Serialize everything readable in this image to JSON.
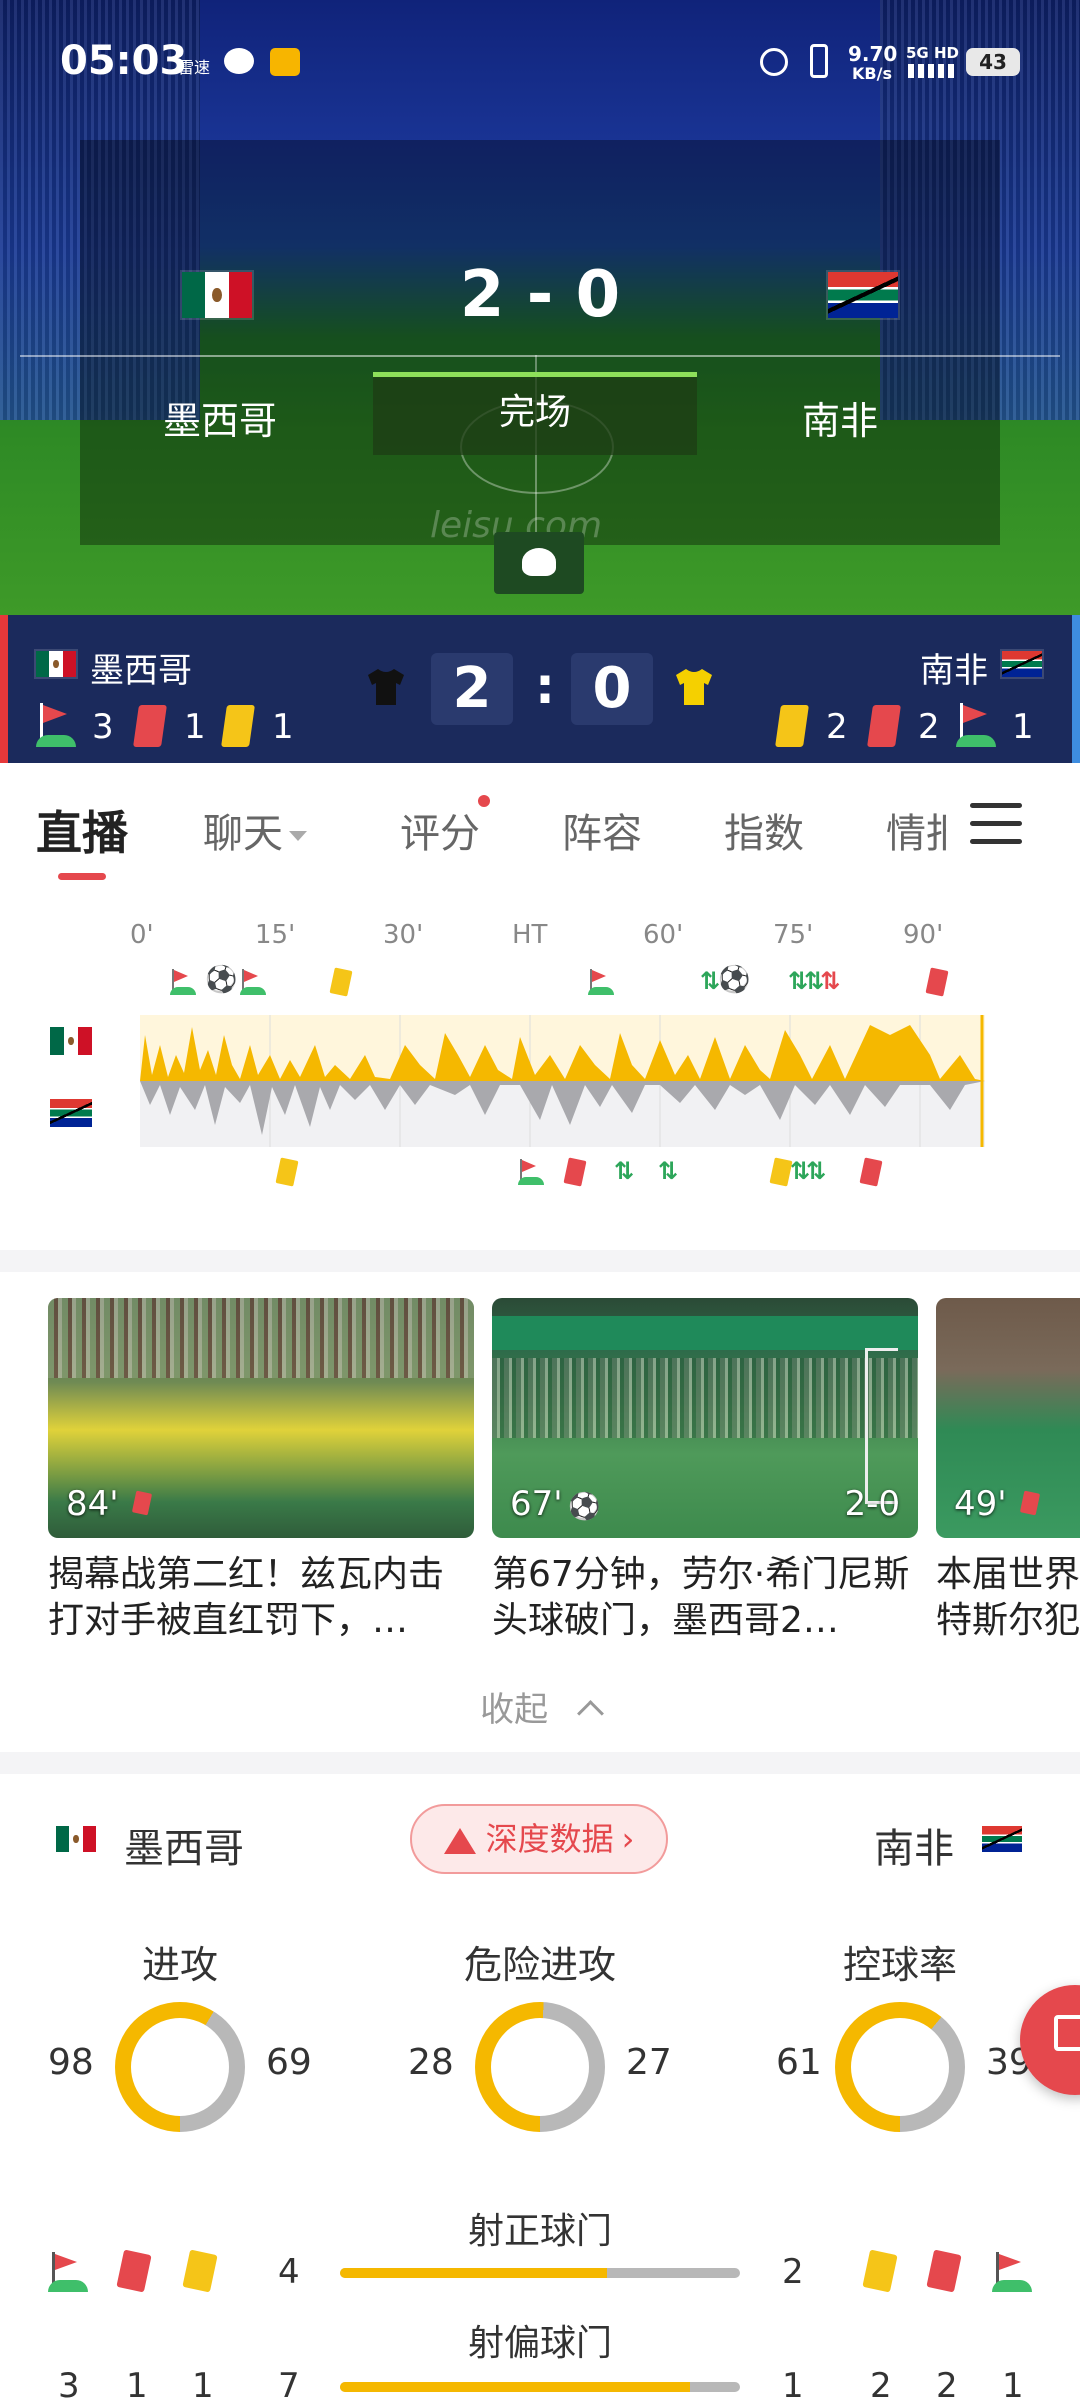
{
  "status_bar": {
    "time": "05:03",
    "app_label": "雷速",
    "network_speed": "9.70",
    "network_unit": "KB/s",
    "signal": "5G HD",
    "battery": "43"
  },
  "match": {
    "home_team": "墨西哥",
    "away_team": "南非",
    "score": "2 - 0",
    "home_score": "2",
    "away_score": "0",
    "score_sep": ":",
    "status": "完场",
    "watermark": "leisu.com",
    "home_stats": {
      "corners": "3",
      "red": "1",
      "yellow": "1"
    },
    "away_stats": {
      "yellow": "2",
      "red": "2",
      "corners": "1"
    },
    "colors": {
      "home_jersey": "#111111",
      "away_jersey": "#f5d000",
      "accent": "#e5484d"
    }
  },
  "tabs": [
    {
      "label": "直播",
      "active": true
    },
    {
      "label": "聊天",
      "dropdown": true
    },
    {
      "label": "评分",
      "dot": true
    },
    {
      "label": "阵容"
    },
    {
      "label": "指数"
    },
    {
      "label": "情报"
    }
  ],
  "timeline": {
    "ticks": [
      "0'",
      "15'",
      "30'",
      "HT",
      "60'",
      "75'",
      "90'"
    ]
  },
  "videos": [
    {
      "minute": "84'",
      "icon": "red-card",
      "title": "揭幕战第二红！兹瓦内击打对手被直红罚下，…"
    },
    {
      "minute": "67'",
      "icon": "ball",
      "score": "2-0",
      "title": "第67分钟，劳尔·希门尼斯头球破门，墨西哥2…"
    },
    {
      "minute": "49'",
      "icon": "red-card",
      "title": "本届世界杯首张红牌！蒙特斯尔犯规破…"
    }
  ],
  "collapse_label": "收起",
  "stats": {
    "home_team": "墨西哥",
    "away_team": "南非",
    "deep_data_label": "深度数据",
    "donuts": [
      {
        "title": "进攻",
        "home": "98",
        "away": "69",
        "home_value": 98,
        "away_value": 69
      },
      {
        "title": "危险进攻",
        "home": "28",
        "away": "27",
        "home_value": 28,
        "away_value": 27
      },
      {
        "title": "控球率",
        "home": "61",
        "away": "39",
        "home_value": 61,
        "away_value": 39
      }
    ],
    "bars": [
      {
        "title": "射正球门",
        "home": "4",
        "away": "2",
        "home_value": 4,
        "away_value": 2
      },
      {
        "title": "射偏球门",
        "home": "7",
        "away": "1",
        "home_value": 7,
        "away_value": 1
      }
    ],
    "home_event_counts": {
      "corners": "3",
      "red": "1",
      "yellow": "1"
    },
    "away_event_counts": {
      "yellow": "2",
      "red": "2",
      "corners": "1"
    }
  }
}
